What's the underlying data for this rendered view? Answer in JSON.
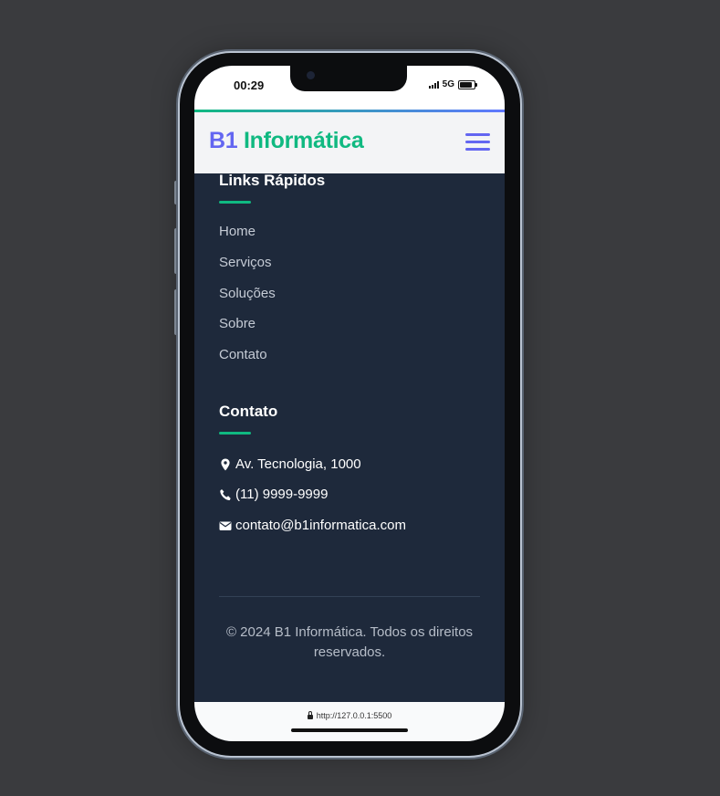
{
  "status_bar": {
    "time": "00:29",
    "network": "5G"
  },
  "header": {
    "brand_part1": "B1",
    "brand_part2": "Informática"
  },
  "quick_links": {
    "title": "Links Rápidos",
    "items": [
      "Home",
      "Serviços",
      "Soluções",
      "Sobre",
      "Contato"
    ]
  },
  "contact": {
    "title": "Contato",
    "address": "Av. Tecnologia, 1000",
    "phone": "(11) 9999-9999",
    "email": "contato@b1informatica.com"
  },
  "footer": {
    "copyright": "© 2024 B1 Informática. Todos os direitos reservados."
  },
  "browser": {
    "url": "http://127.0.0.1:5500"
  },
  "colors": {
    "accent_green": "#10b981",
    "accent_indigo": "#6366f1",
    "footer_bg": "#1e293b"
  },
  "icons": [
    "map-marker-icon",
    "phone-icon",
    "envelope-icon",
    "menu-icon",
    "lock-icon"
  ]
}
